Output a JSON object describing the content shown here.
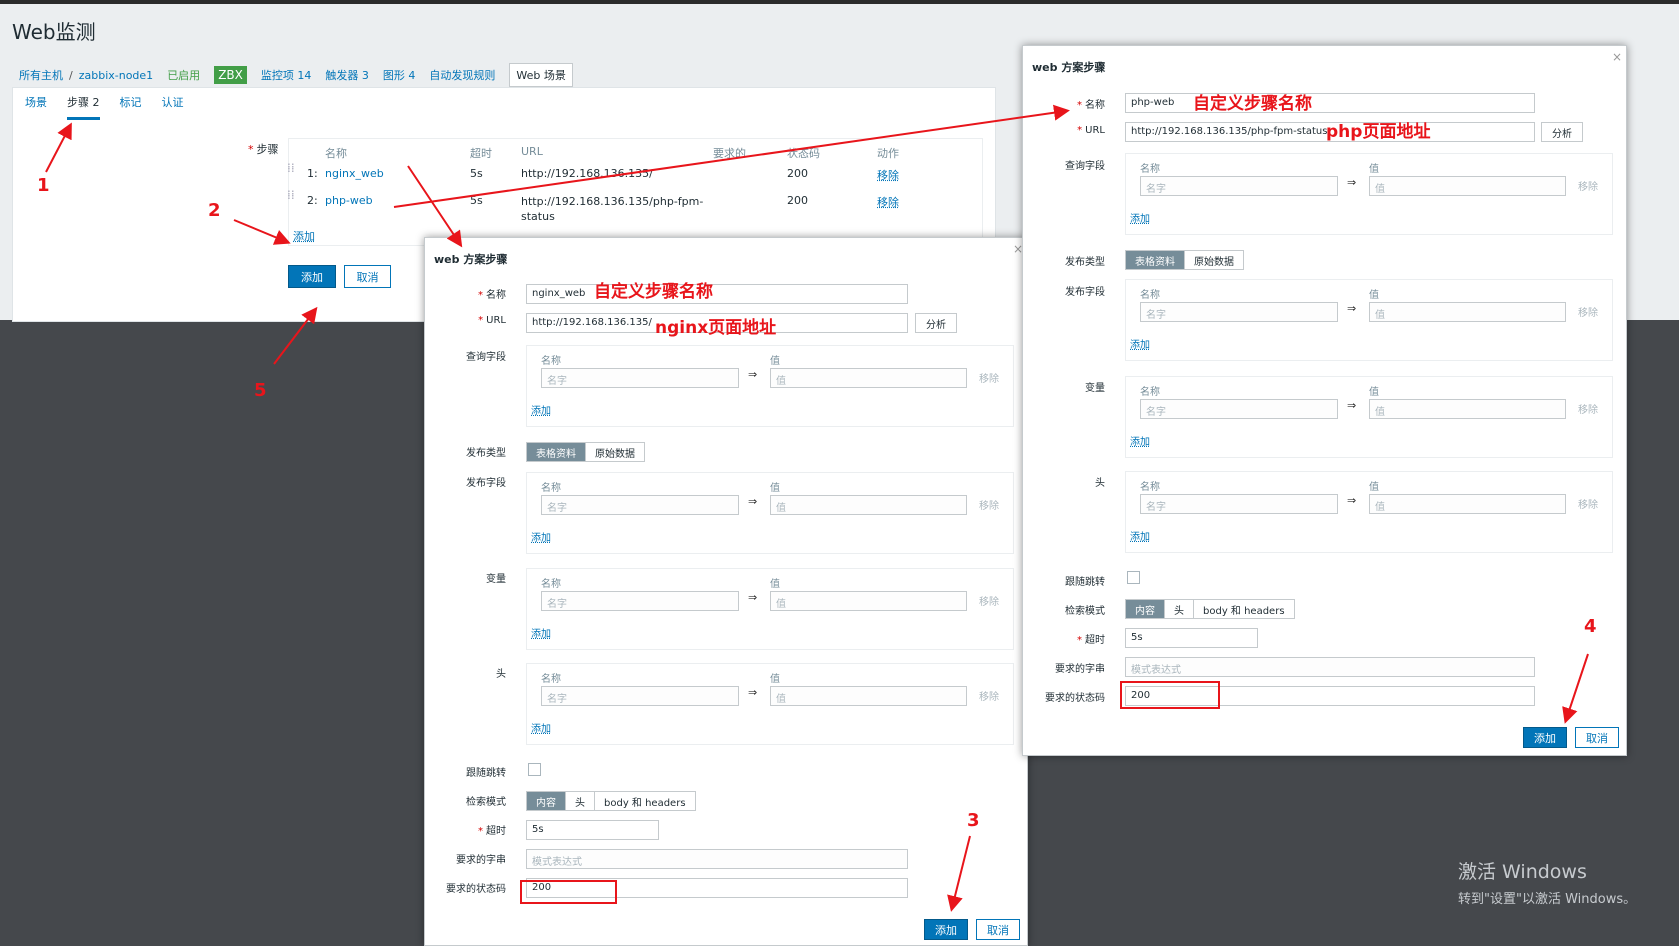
{
  "page_title": "Web监测",
  "breadcrumb": {
    "all_hosts": "所有主机",
    "separator": "/",
    "host": "zabbix-node1",
    "enabled": "已启用",
    "zbx": "ZBX",
    "items": "监控项 14",
    "triggers": "触发器 3",
    "graphs": "图形 4",
    "discovery": "自动发现规则",
    "web": "Web 场景"
  },
  "tabs": {
    "scenario": "场景",
    "steps": "步骤 2",
    "tags": "标记",
    "auth": "认证"
  },
  "steps_table": {
    "label": "步骤",
    "required": "*",
    "headers": {
      "name": "名称",
      "timeout": "超时",
      "url": "URL",
      "required": "要求的",
      "status": "状态码",
      "action": "动作"
    },
    "rows": [
      {
        "num": "1:",
        "name": "nginx_web",
        "timeout": "5s",
        "url": "http://192.168.136.135/",
        "status": "200",
        "action": "移除"
      },
      {
        "num": "2:",
        "name": "php-web",
        "timeout": "5s",
        "url": "http://192.168.136.135/php-fpm-status",
        "status": "200",
        "action": "移除"
      }
    ],
    "add_link": "添加",
    "add_button": "添加",
    "cancel_button": "取消"
  },
  "dialog_common": {
    "title": "web 方案步骤",
    "close": "×",
    "name_label": "名称",
    "url_label": "URL",
    "parse_button": "分析",
    "query_label": "查询字段",
    "post_type_label": "发布类型",
    "post_type_options": [
      "表格资料",
      "原始数据"
    ],
    "post_fields_label": "发布字段",
    "variables_label": "变量",
    "headers_label": "头",
    "kv_name_header": "名称",
    "kv_value_header": "值",
    "kv_name_placeholder": "名字",
    "kv_value_placeholder": "值",
    "kv_arrow": "⇒",
    "kv_remove": "移除",
    "kv_add": "添加",
    "follow_label": "跟随跳转",
    "retrieve_label": "检索模式",
    "retrieve_options": [
      "内容",
      "头",
      "body 和 headers"
    ],
    "timeout_label": "超时",
    "required_string_label": "要求的字串",
    "required_string_placeholder": "模式表达式",
    "status_label": "要求的状态码",
    "add_button": "添加",
    "cancel_button": "取消"
  },
  "dialog_nginx": {
    "name": "nginx_web",
    "url": "http://192.168.136.135/",
    "timeout": "5s",
    "status_codes": "200"
  },
  "dialog_php": {
    "name": "php-web",
    "url": "http://192.168.136.135/php-fpm-status",
    "timeout": "5s",
    "status_codes": "200"
  },
  "annotations": {
    "n1": "1",
    "n2": "2",
    "n3": "3",
    "n4": "4",
    "n5": "5",
    "nginx_name_note": "自定义步骤名称",
    "nginx_url_note": "nginx页面地址",
    "php_name_note": "自定义步骤名称",
    "php_url_note": "php页面地址",
    "color": "#e8151b"
  },
  "watermark": {
    "line1": "激活 Windows",
    "line2": "转到\"设置\"以激活 Windows。"
  }
}
